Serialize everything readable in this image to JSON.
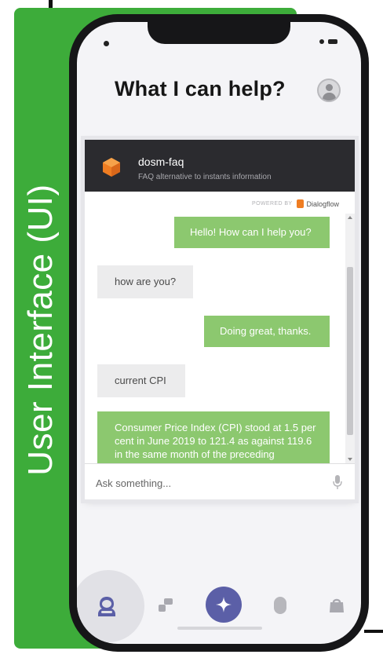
{
  "figure_label": "User Interface (UI)",
  "page": {
    "title": "What I can help?"
  },
  "chatbot": {
    "name": "dosm-faq",
    "description": "FAQ alternative to instants information",
    "powered_by": "POWERED BY",
    "powered_by_brand": "Dialogflow",
    "messages": [
      {
        "sender": "bot",
        "text": "Hello! How can I help you?"
      },
      {
        "sender": "user",
        "text": "how are you?"
      },
      {
        "sender": "bot",
        "text": "Doing great, thanks."
      },
      {
        "sender": "user",
        "text": "current CPI"
      },
      {
        "sender": "bot",
        "text": "Consumer Price Index (CPI) stood at 1.5 per cent in June 2019 to 121.4 as against 119.6 in the same month of the preceding"
      }
    ],
    "input_placeholder": "Ask something..."
  },
  "tab_bar": {
    "tabs": [
      {
        "icon": "profile-icon",
        "active": true
      },
      {
        "icon": "music-note-icon",
        "active": false
      },
      {
        "icon": "sparkle-icon",
        "active": false
      },
      {
        "icon": "lightbulb-icon",
        "active": false
      },
      {
        "icon": "bag-icon",
        "active": false
      }
    ]
  },
  "colors": {
    "panel_green": "#3dac3a",
    "bot_bubble": "#8cc86f",
    "user_bubble": "#ececed",
    "chat_header": "#2b2b2f",
    "tab_center": "#5b5fa7",
    "dialogflow_orange": "#ef7d22"
  }
}
